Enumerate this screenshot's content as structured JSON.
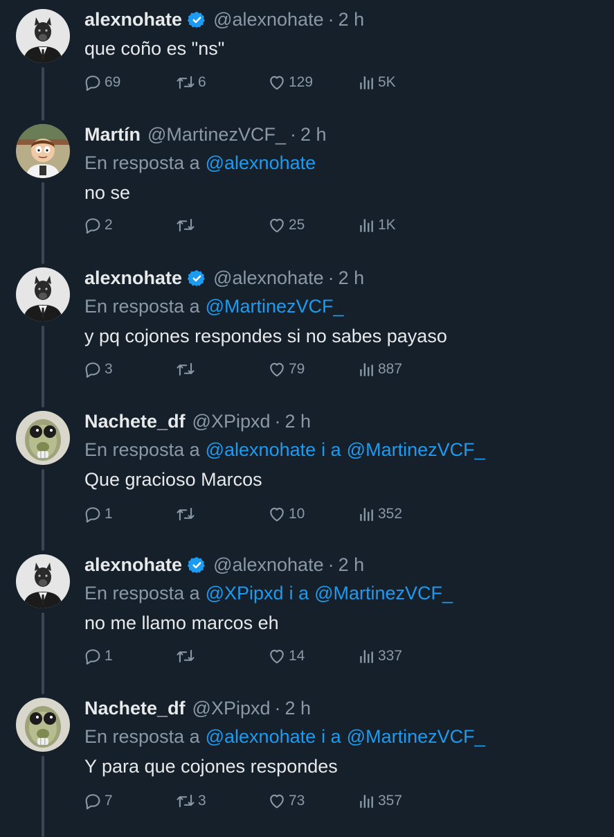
{
  "colors": {
    "background": "#15202b",
    "text": "#e7e9ea",
    "secondary": "#8b98a5",
    "link": "#1d9bf0",
    "verified": "#1d9bf0",
    "thread_line": "#3a4653"
  },
  "icons": {
    "reply": "speech-bubble-icon",
    "retweet": "retweet-icon",
    "like": "heart-icon",
    "views": "bar-chart-icon",
    "verified": "verified-badge-icon"
  },
  "tweets": [
    {
      "name": "alexnohate",
      "verified": true,
      "handle": "@alexnohate",
      "sep": "·",
      "time": "2 h",
      "reply_prefix": "",
      "reply_mention_1": "",
      "reply_conj": "",
      "reply_mention_2": "",
      "text": "que coño es \"ns\"",
      "replies": "69",
      "retweets": "6",
      "likes": "129",
      "views": "5K",
      "avatar": "suit-wolf"
    },
    {
      "name": "Martín",
      "verified": false,
      "handle": "@MartinezVCF_",
      "sep": "·",
      "time": "2 h",
      "reply_prefix": "En resposta a",
      "reply_mention_1": "@alexnohate",
      "reply_conj": "",
      "reply_mention_2": "",
      "text": "no se",
      "replies": "2",
      "retweets": "",
      "likes": "25",
      "views": "1K",
      "avatar": "cartoon-boy"
    },
    {
      "name": "alexnohate",
      "verified": true,
      "handle": "@alexnohate",
      "sep": "·",
      "time": "2 h",
      "reply_prefix": "En resposta a",
      "reply_mention_1": "@MartinezVCF_",
      "reply_conj": "",
      "reply_mention_2": "",
      "text": "y pq cojones respondes si no sabes payaso",
      "replies": "3",
      "retweets": "",
      "likes": "79",
      "views": "887",
      "avatar": "suit-wolf"
    },
    {
      "name": "Nachete_df",
      "verified": false,
      "handle": "@XPipxd",
      "sep": "·",
      "time": "2 h",
      "reply_prefix": "En resposta a",
      "reply_mention_1": "@alexnohate",
      "reply_conj": "i a",
      "reply_mention_2": "@MartinezVCF_",
      "text": "Que gracioso Marcos",
      "replies": "1",
      "retweets": "",
      "likes": "10",
      "views": "352",
      "avatar": "blurry-face"
    },
    {
      "name": "alexnohate",
      "verified": true,
      "handle": "@alexnohate",
      "sep": "·",
      "time": "2 h",
      "reply_prefix": "En resposta a",
      "reply_mention_1": "@XPipxd",
      "reply_conj": "i a",
      "reply_mention_2": "@MartinezVCF_",
      "text": "no me llamo marcos eh",
      "replies": "1",
      "retweets": "",
      "likes": "14",
      "views": "337",
      "avatar": "suit-wolf"
    },
    {
      "name": "Nachete_df",
      "verified": false,
      "handle": "@XPipxd",
      "sep": "·",
      "time": "2 h",
      "reply_prefix": "En resposta a",
      "reply_mention_1": "@alexnohate",
      "reply_conj": "i a",
      "reply_mention_2": "@MartinezVCF_",
      "text": "Y para que cojones respondes",
      "replies": "7",
      "retweets": "3",
      "likes": "73",
      "views": "357",
      "avatar": "blurry-face"
    }
  ]
}
